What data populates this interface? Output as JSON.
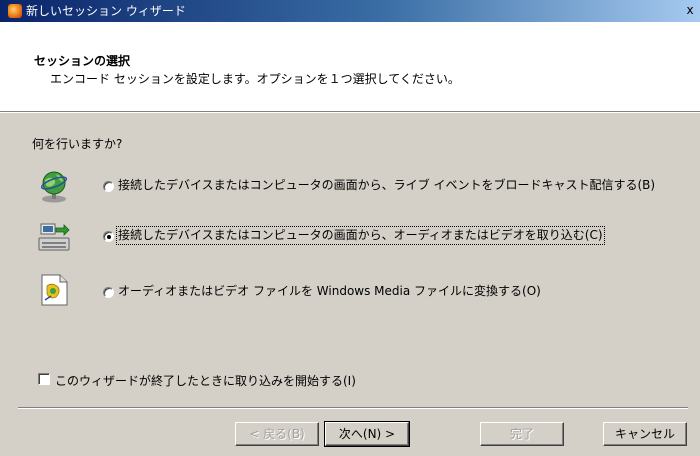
{
  "window": {
    "title": "新しいセッション ウィザード",
    "close_label": "x"
  },
  "header": {
    "title": "セッションの選択",
    "subtitle": "エンコード セッションを設定します。オプションを１つ選択してください。"
  },
  "main": {
    "question": "何を行いますか?",
    "options": [
      {
        "label": "接続したデバイスまたはコンピュータの画面から、ライブ イベントをブロードキャスト配信する(B)",
        "icon": "broadcast-globe-icon",
        "selected": false
      },
      {
        "label": "接続したデバイスまたはコンピュータの画面から、オーディオまたはビデオを取り込む(C)",
        "icon": "capture-device-icon",
        "selected": true
      },
      {
        "label": "オーディオまたはビデオ ファイルを Windows Media ファイルに変換する(O)",
        "icon": "convert-file-icon",
        "selected": false
      }
    ],
    "start_capture_label": "このウィザードが終了したときに取り込みを開始する(I)"
  },
  "footer": {
    "back_label": "< 戻る(B)",
    "next_label": "次へ(N) >",
    "finish_label": "完了",
    "cancel_label": "キャンセル"
  }
}
